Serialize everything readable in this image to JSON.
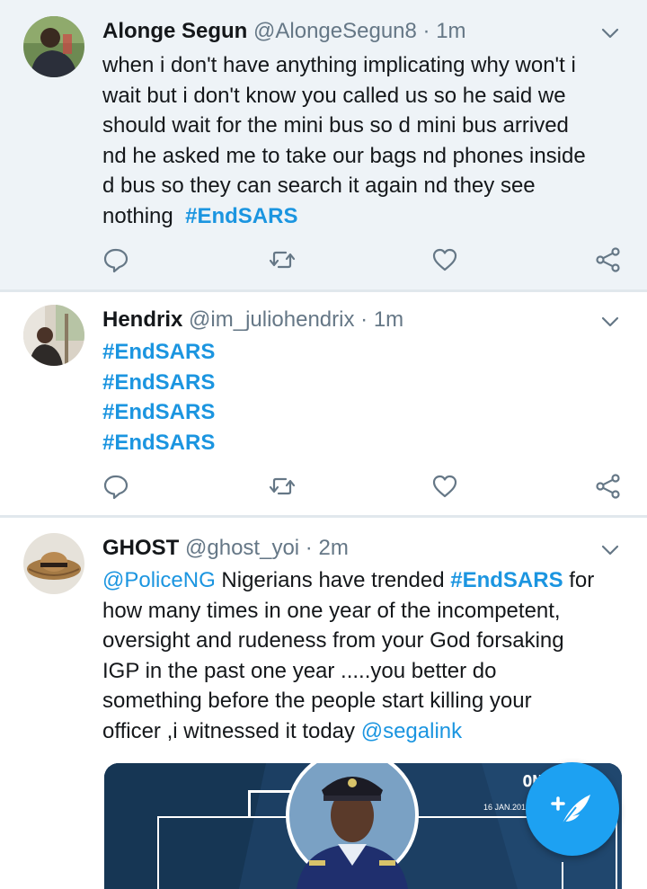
{
  "colors": {
    "accent": "#1da1f2",
    "link": "#1b95e0",
    "muted": "#657786",
    "highlight_bg": "#eef3f7"
  },
  "tweets": [
    {
      "name": "Alonge Segun",
      "handle": "@AlongeSegun8",
      "dot": "·",
      "time": "1m",
      "lines": [
        "when i don't have anything implicating  why won't i",
        "wait but i don't know you called us so he said we",
        "should wait for the mini bus so d mini bus arrived",
        "nd he asked me to take our bags nd phones inside",
        "d  bus so they can search it again nd they see",
        "nothing"
      ],
      "hashtag": "#EndSARS",
      "icons": [
        "reply-icon",
        "retweet-icon",
        "like-icon",
        "share-icon"
      ]
    },
    {
      "name": "Hendrix",
      "handle": "@im_juliohendrix",
      "dot": "·",
      "time": "1m",
      "hashtags": [
        "#EndSARS",
        "#EndSARS",
        "#EndSARS",
        "#EndSARS"
      ],
      "icons": [
        "reply-icon",
        "retweet-icon",
        "like-icon",
        "share-icon"
      ]
    },
    {
      "name": "GHOST",
      "handle": "@ghost_yoi",
      "dot": "·",
      "time": "2m",
      "mention1": "@PoliceNG",
      "text1": " Nigerians have trended ",
      "hashtag": "#EndSARS",
      "text2": " for",
      "lines": [
        "how many times in one year of the incompetent,",
        "oversight and rudeness from your God forsaking",
        "IGP in the past one year .....you better do",
        "something before the people start killing your"
      ],
      "last_line": "officer ,i witnessed it today ",
      "mention2": "@segalink",
      "media": {
        "label_top": "ONE",
        "label_date": "16 JAN.2019"
      }
    }
  ],
  "compose": {
    "icon": "compose-tweet-icon",
    "plus": "+"
  }
}
